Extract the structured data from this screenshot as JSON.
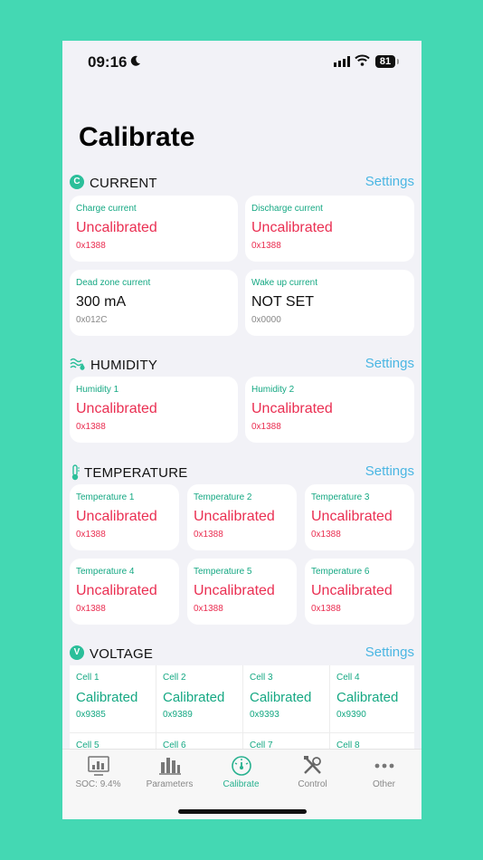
{
  "status": {
    "time": "09:16",
    "battery": "81"
  },
  "page": {
    "title": "Calibrate"
  },
  "sections": {
    "current": {
      "badge": "C",
      "title": "CURRENT",
      "settings": "Settings",
      "cards": [
        {
          "label": "Charge current",
          "value": "Uncalibrated",
          "sub": "0x1388"
        },
        {
          "label": "Discharge current",
          "value": "Uncalibrated",
          "sub": "0x1388"
        },
        {
          "label": "Dead zone current",
          "value": "300 mA",
          "sub": "0x012C"
        },
        {
          "label": "Wake up current",
          "value": "NOT SET",
          "sub": "0x0000"
        }
      ]
    },
    "humidity": {
      "title": "HUMIDITY",
      "settings": "Settings",
      "cards": [
        {
          "label": "Humidity 1",
          "value": "Uncalibrated",
          "sub": "0x1388"
        },
        {
          "label": "Humidity 2",
          "value": "Uncalibrated",
          "sub": "0x1388"
        }
      ]
    },
    "temperature": {
      "title": "TEMPERATURE",
      "settings": "Settings",
      "cards": [
        {
          "label": "Temperature 1",
          "value": "Uncalibrated",
          "sub": "0x1388"
        },
        {
          "label": "Temperature 2",
          "value": "Uncalibrated",
          "sub": "0x1388"
        },
        {
          "label": "Temperature 3",
          "value": "Uncalibrated",
          "sub": "0x1388"
        },
        {
          "label": "Temperature 4",
          "value": "Uncalibrated",
          "sub": "0x1388"
        },
        {
          "label": "Temperature 5",
          "value": "Uncalibrated",
          "sub": "0x1388"
        },
        {
          "label": "Temperature 6",
          "value": "Uncalibrated",
          "sub": "0x1388"
        }
      ]
    },
    "voltage": {
      "badge": "V",
      "title": "VOLTAGE",
      "settings": "Settings",
      "cells": [
        {
          "label": "Cell 1",
          "value": "Calibrated",
          "sub": "0x9385"
        },
        {
          "label": "Cell 2",
          "value": "Calibrated",
          "sub": "0x9389"
        },
        {
          "label": "Cell 3",
          "value": "Calibrated",
          "sub": "0x9393"
        },
        {
          "label": "Cell 4",
          "value": "Calibrated",
          "sub": "0x9390"
        },
        {
          "label": "Cell 5"
        },
        {
          "label": "Cell 6"
        },
        {
          "label": "Cell 7"
        },
        {
          "label": "Cell 8"
        }
      ]
    }
  },
  "tabs": [
    {
      "label": "SOC: 9.4%",
      "icon": "chart-icon"
    },
    {
      "label": "Parameters",
      "icon": "bars-icon"
    },
    {
      "label": "Calibrate",
      "icon": "gauge-icon",
      "active": true
    },
    {
      "label": "Control",
      "icon": "tools-icon"
    },
    {
      "label": "Other",
      "icon": "ellipsis-icon"
    }
  ],
  "colors": {
    "background": "#44d8b3",
    "accent": "#15a883",
    "uncalibrated": "#ea2f52",
    "settings_link": "#4ab6e3"
  }
}
